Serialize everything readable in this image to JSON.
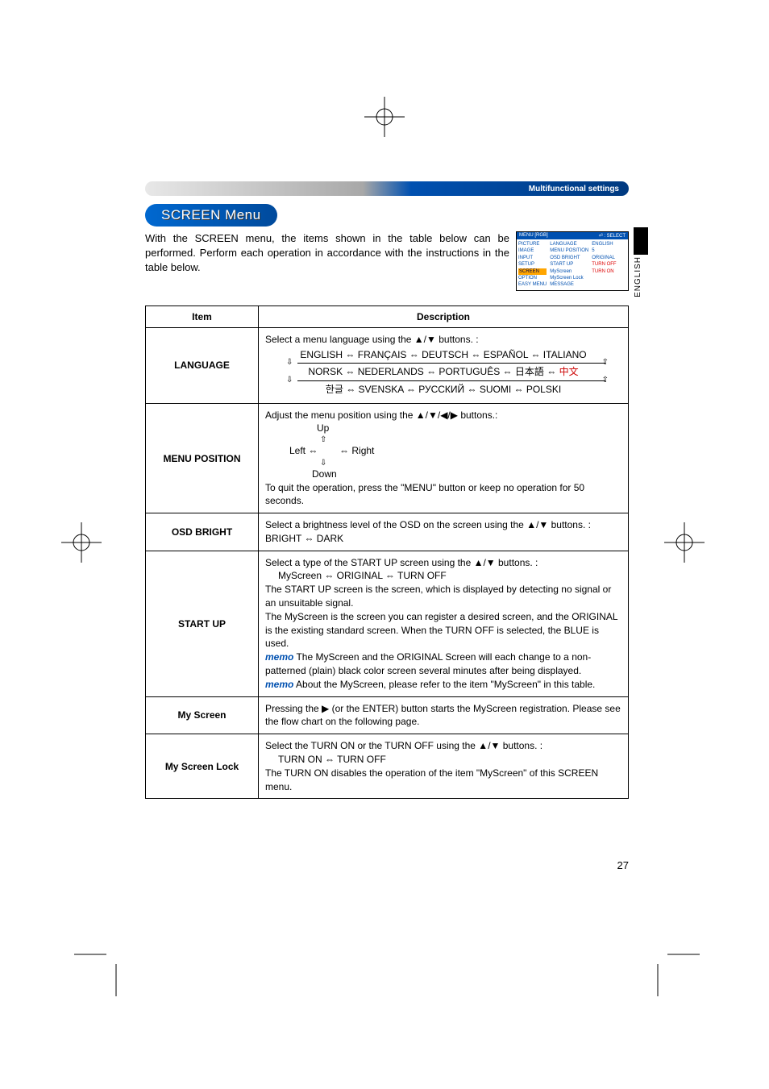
{
  "header": {
    "section": "Multifunctional settings"
  },
  "title": "SCREEN Menu",
  "intro": "With the SCREEN menu, the items shown in the table below can be performed. Perform each operation in accordance with the instructions in the table below.",
  "osd": {
    "headerLeft": "MENU [RGB]",
    "headerRight": "⏎ : SELECT",
    "col1": [
      "PICTURE",
      "IMAGE",
      "INPUT",
      "SETUP",
      "SCREEN",
      "OPTION",
      "EASY MENU"
    ],
    "col2": [
      "LANGUAGE",
      "MENU POSITION",
      "OSD BRIGHT",
      "START UP",
      "MyScreen",
      "MyScreen Lock",
      "MESSAGE"
    ],
    "col3": [
      "ENGLISH",
      "",
      "5",
      "ORIGINAL",
      "",
      "TURN OFF",
      "TURN ON"
    ]
  },
  "sideLabel": "ENGLISH",
  "table": {
    "headItem": "Item",
    "headDesc": "Description",
    "rows": {
      "language": {
        "item": "LANGUAGE",
        "line1": "Select a menu language using the ▲/▼ buttons. :",
        "chain1": "ENGLISH ⇔ FRANÇAIS ⇔ DEUTSCH ⇔ ESPAÑOL ⇔ ITALIANO",
        "chain2a": "NORSK ⇔ NEDERLANDS ⇔ PORTUGUÊS ⇔ 日本語 ⇔ ",
        "chain2b": "中文",
        "chain3": "한글 ⇔ SVENSKA ⇔ РУССКИЙ ⇔ SUOMI ⇔ POLSKI"
      },
      "menuPosition": {
        "item": "MENU POSITION",
        "line1": "Adjust the menu position using the ▲/▼/◀/▶ buttons.:",
        "up": "Up",
        "arrUp": "⇧",
        "leftRight": "Left ⇔        ⇔ Right",
        "arrDown": "⇩",
        "down": "Down",
        "line2": "To quit the operation, press the \"MENU\" button or keep no operation for 50 seconds."
      },
      "osdBright": {
        "item": "OSD BRIGHT",
        "line1": "Select a brightness level of the OSD on the screen using the ▲/▼ buttons. :",
        "line2": "BRIGHT ⇔ DARK"
      },
      "startUp": {
        "item": "START UP",
        "line1": "Select a type of the START UP screen using the ▲/▼ buttons. :",
        "chain": "MyScreen ⇔ ORIGINAL ⇔ TURN OFF",
        "para1": "The START UP screen is the screen, which is displayed by detecting no signal or an unsuitable signal.",
        "para2": "The MyScreen is the screen you can register a desired screen, and the ORIGINAL is the existing standard screen. When the TURN OFF is selected, the BLUE is used.",
        "memo1": " The MyScreen and the ORIGINAL Screen will each change to a non-patterned (plain) black color screen several minutes after being displayed.",
        "memo2": " About the MyScreen, please refer to the item \"MyScreen\" in this table."
      },
      "myScreen": {
        "item": "My Screen",
        "desc": "Pressing the ▶ (or the ENTER) button starts the MyScreen registration. Please see the flow chart on the following page."
      },
      "myScreenLock": {
        "item": "My Screen Lock",
        "line1": "Select the TURN ON or the TURN OFF using the ▲/▼ buttons. :",
        "chain": "TURN ON ⇔ TURN OFF",
        "line2": "The TURN ON disables the operation of the item \"MyScreen\" of this SCREEN menu."
      }
    }
  },
  "pageNumber": "27",
  "memoLabel": "memo"
}
